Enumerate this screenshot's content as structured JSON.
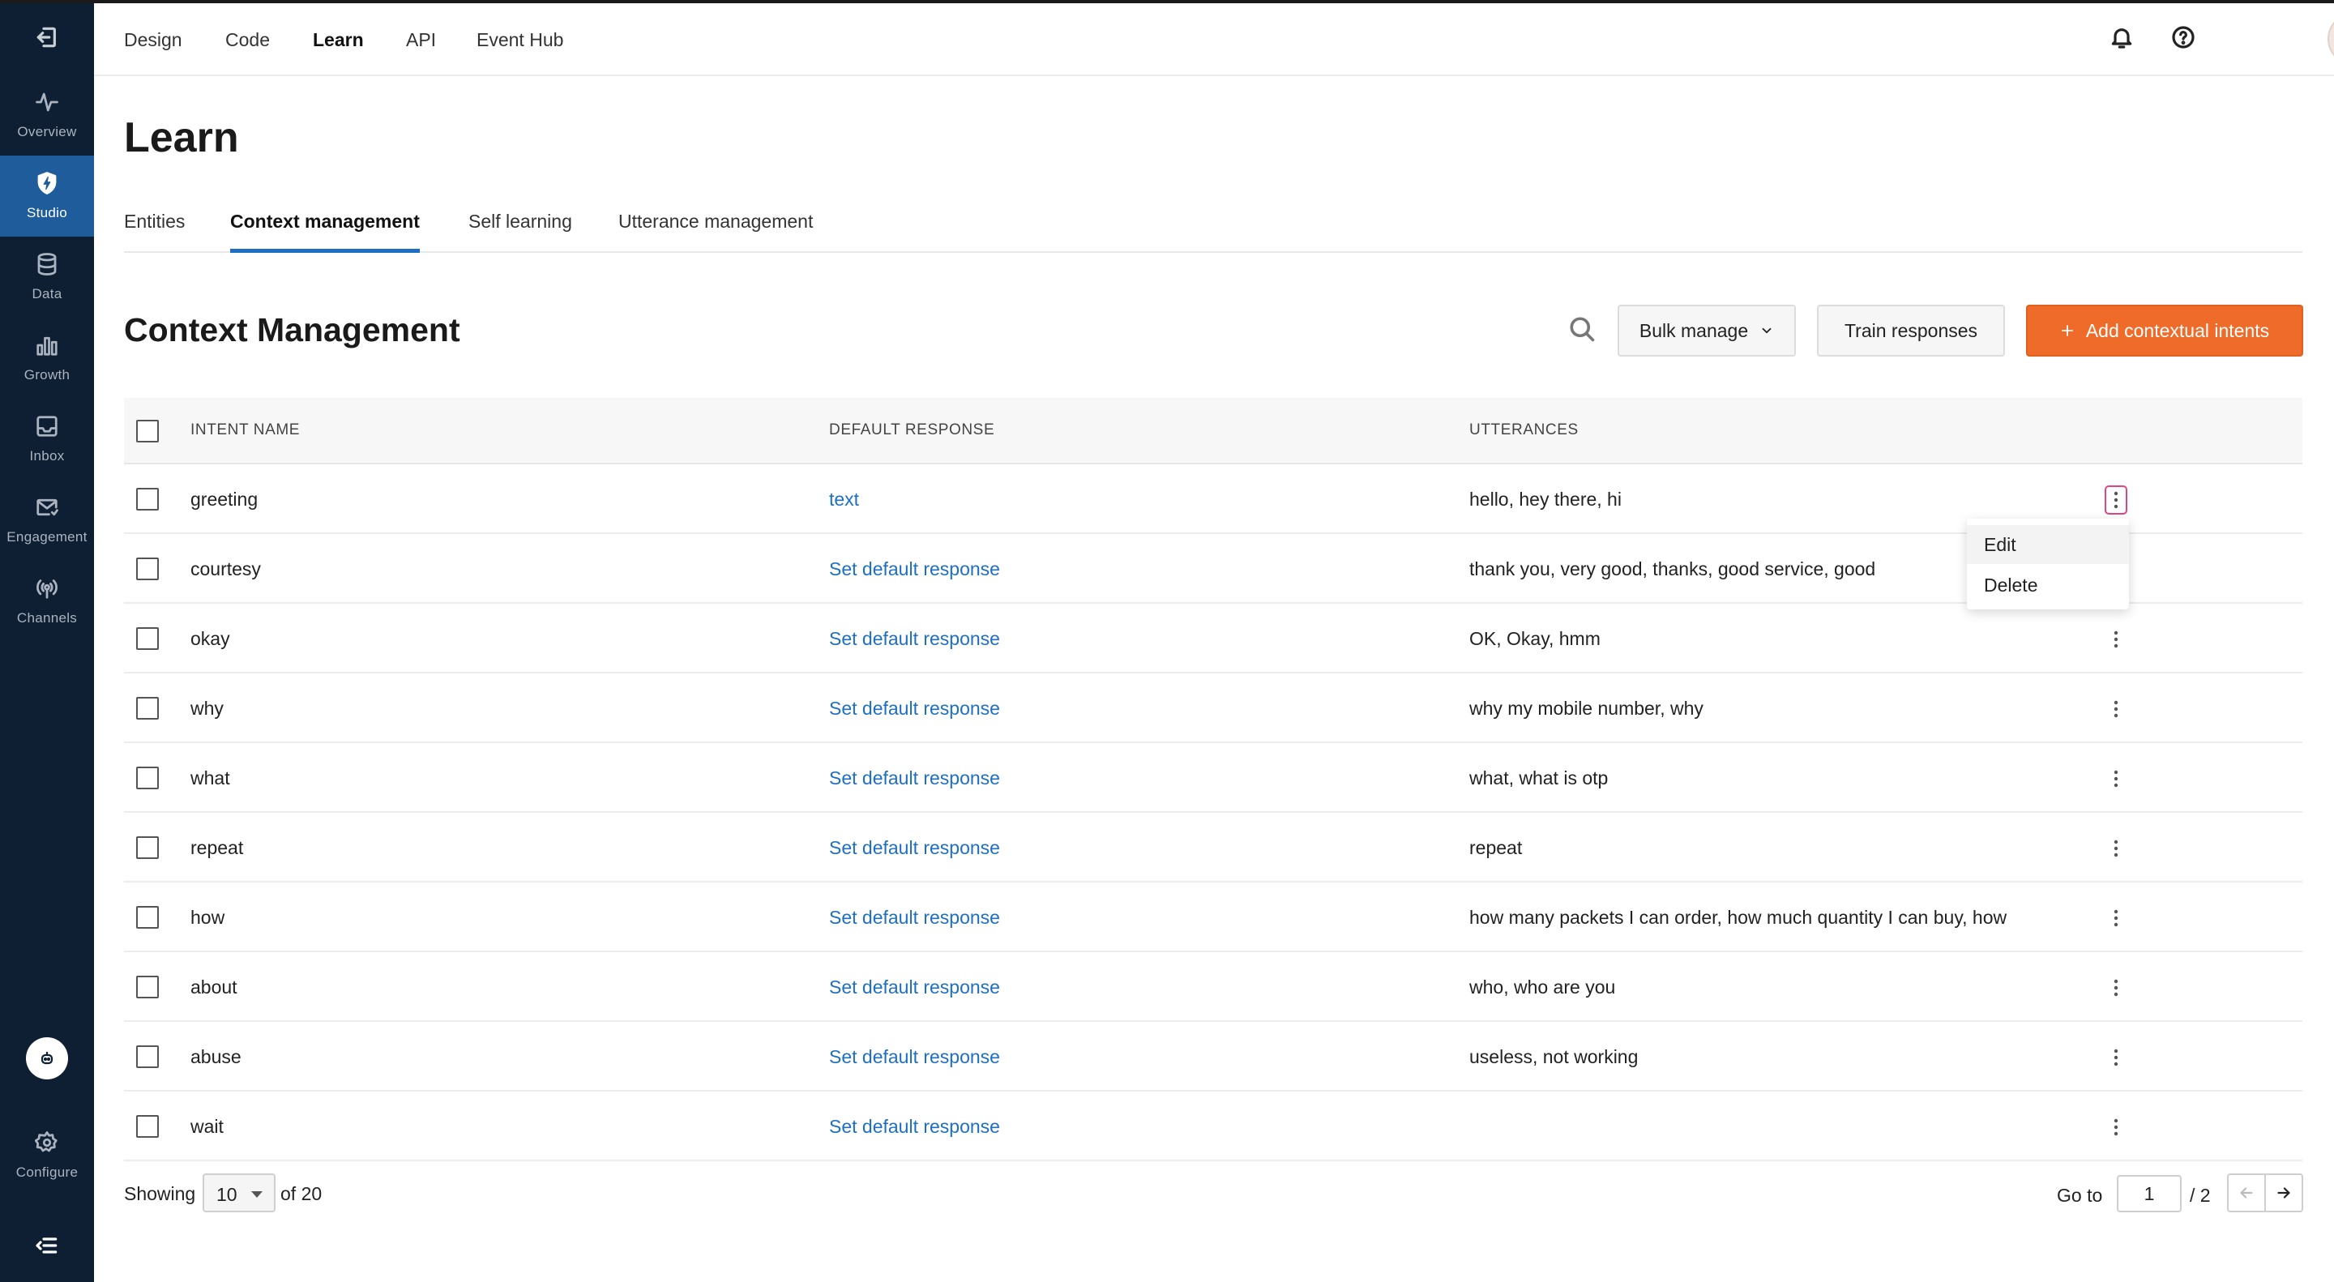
{
  "sidebar": {
    "exit_icon": "exit-icon",
    "items": [
      {
        "label": "Overview",
        "icon": "activity-icon",
        "active": false
      },
      {
        "label": "Studio",
        "icon": "shield-bolt-icon",
        "active": true
      },
      {
        "label": "Data",
        "icon": "database-icon",
        "active": false
      },
      {
        "label": "Growth",
        "icon": "bar-chart-icon",
        "active": false
      },
      {
        "label": "Inbox",
        "icon": "inbox-icon",
        "active": false
      },
      {
        "label": "Engagement",
        "icon": "mail-icon",
        "active": false
      },
      {
        "label": "Channels",
        "icon": "broadcast-icon",
        "active": false
      }
    ],
    "configure_label": "Configure"
  },
  "topnav": {
    "items": [
      {
        "label": "Design",
        "active": false
      },
      {
        "label": "Code",
        "active": false
      },
      {
        "label": "Learn",
        "active": true
      },
      {
        "label": "API",
        "active": false
      },
      {
        "label": "Event Hub",
        "active": false
      }
    ]
  },
  "page": {
    "title": "Learn",
    "tabs": [
      {
        "label": "Entities",
        "active": false
      },
      {
        "label": "Context management",
        "active": true
      },
      {
        "label": "Self learning",
        "active": false
      },
      {
        "label": "Utterance management",
        "active": false
      }
    ]
  },
  "section": {
    "title": "Context Management",
    "bulk_manage_label": "Bulk manage",
    "train_label": "Train responses",
    "add_label": "Add contextual intents"
  },
  "table": {
    "headers": {
      "intent": "INTENT NAME",
      "response": "DEFAULT RESPONSE",
      "utterances": "UTTERANCES"
    },
    "rows": [
      {
        "intent": "greeting",
        "response": "text",
        "utterances": "hello, hey there, hi"
      },
      {
        "intent": "courtesy",
        "response": "Set default response",
        "utterances": "thank you, very good, thanks, good service, good"
      },
      {
        "intent": "okay",
        "response": "Set default response",
        "utterances": "OK, Okay, hmm"
      },
      {
        "intent": "why",
        "response": "Set default response",
        "utterances": "why my mobile number, why"
      },
      {
        "intent": "what",
        "response": "Set default response",
        "utterances": "what, what is otp"
      },
      {
        "intent": "repeat",
        "response": "Set default response",
        "utterances": "repeat"
      },
      {
        "intent": "how",
        "response": "Set default response",
        "utterances": "how many packets I can order, how much quantity I can buy, how"
      },
      {
        "intent": "about",
        "response": "Set default response",
        "utterances": "who, who are you"
      },
      {
        "intent": "abuse",
        "response": "Set default response",
        "utterances": "useless, not working"
      },
      {
        "intent": "wait",
        "response": "Set default response",
        "utterances": ""
      }
    ]
  },
  "row_menu": {
    "edit_label": "Edit",
    "delete_label": "Delete"
  },
  "pagination": {
    "showing_label": "Showing",
    "page_size": "10",
    "of_label": "of 20",
    "goto_label": "Go to",
    "current_page": "1",
    "total_pages_label": "/ 2"
  },
  "colors": {
    "accent": "#1e6fc3",
    "primary_button": "#ef6b29",
    "sidebar_bg": "#0e1f33",
    "sidebar_active": "#1e5c9c"
  }
}
